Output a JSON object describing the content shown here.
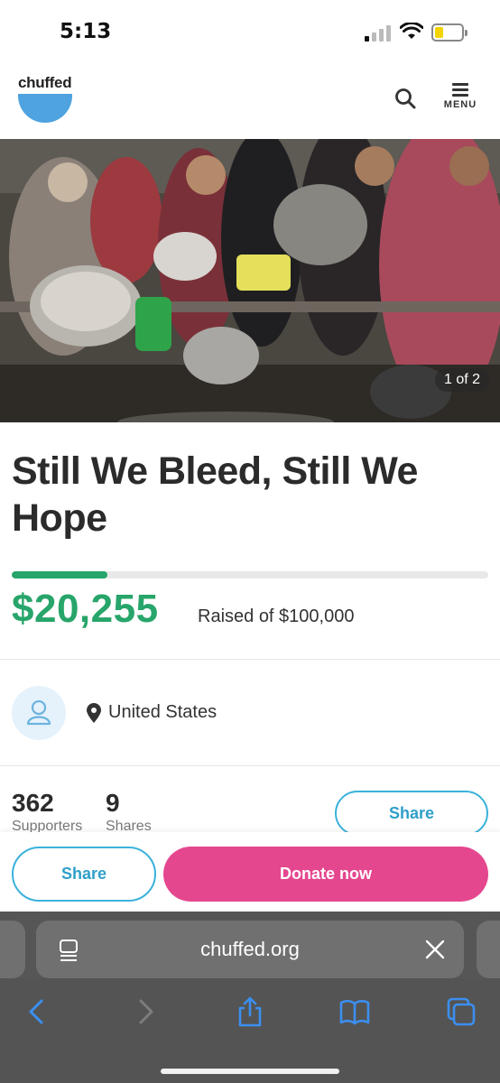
{
  "status_bar": {
    "time": "5:13"
  },
  "header": {
    "logo_text": "chuffed",
    "menu_label": "MENU"
  },
  "hero": {
    "image_counter": "1 of 2"
  },
  "campaign": {
    "title": "Still We Bleed, Still We Hope",
    "raised_amount": "$20,255",
    "raised_label": "Raised of $100,000",
    "progress_fraction": 0.2,
    "location": "United States"
  },
  "stats": {
    "supporters_count": "362",
    "supporters_label": "Supporters",
    "shares_count": "9",
    "shares_label": "Shares",
    "share_button": "Share"
  },
  "sticky_bar": {
    "share_button": "Share",
    "donate_button": "Donate now"
  },
  "browser": {
    "url": "chuffed.org"
  },
  "colors": {
    "accent_green": "#27a56a",
    "donate_pink": "#e5478f",
    "share_blue": "#3ab2db",
    "logo_blue": "#4ea3e0"
  }
}
